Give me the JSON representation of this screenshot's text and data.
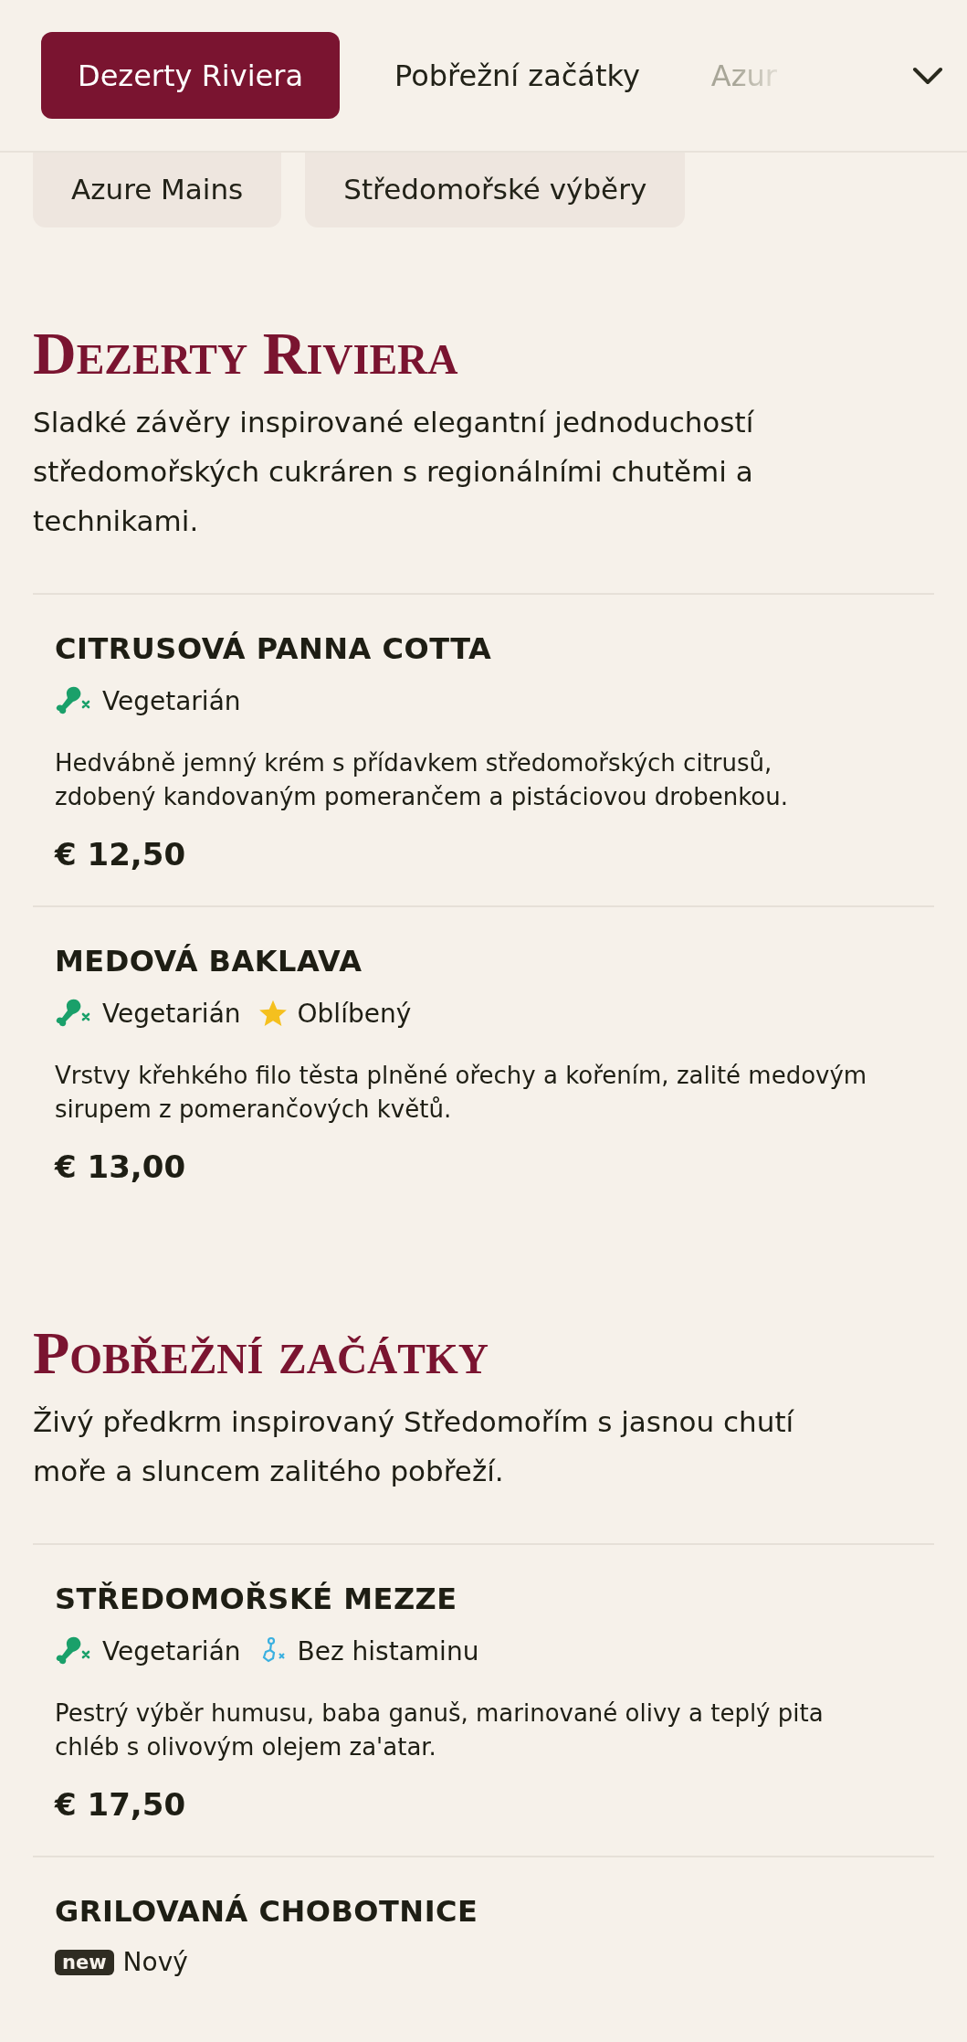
{
  "tabs": [
    {
      "label": "Dezerty Riviera",
      "selected": true
    },
    {
      "label": "Pobřežní začátky",
      "selected": false
    },
    {
      "label": "Azur",
      "selected": false
    }
  ],
  "more_tabs": [
    {
      "label": "Azure Mains",
      "selected": false
    },
    {
      "label": "Středomořské výběry",
      "selected": false
    }
  ],
  "sections": [
    {
      "title": "Dezerty Riviera",
      "description": "Sladké závěry inspirované elegantní jednoduchostí středomořských cukráren s regionálními chutěmi a technikami.",
      "items": [
        {
          "name": "CITRUSOVÁ PANNA COTTA",
          "tags": [
            {
              "kind": "vegetarian",
              "label": "Vegetarián"
            }
          ],
          "description": "Hedvábně jemný krém s přídavkem středomořských citrusů, zdobený kandovaným pomerančem a pistáciovou drobenkou.",
          "price": "€ 12,50"
        },
        {
          "name": "MEDOVÁ BAKLAVA",
          "tags": [
            {
              "kind": "vegetarian",
              "label": "Vegetarián"
            },
            {
              "kind": "popular",
              "label": "Oblíbený"
            }
          ],
          "description": "Vrstvy křehkého filo těsta plněné ořechy a kořením, zalité medovým sirupem z pomerančových květů.",
          "price": "€ 13,00"
        }
      ]
    },
    {
      "title": "Pobřežní začátky",
      "description": "Živý předkrm inspirovaný Středomořím s jasnou chutí moře a sluncem zalitého pobřeží.",
      "items": [
        {
          "name": "STŘEDOMOŘSKÉ MEZZE",
          "tags": [
            {
              "kind": "vegetarian",
              "label": "Vegetarián"
            },
            {
              "kind": "histamine-free",
              "label": "Bez histaminu"
            }
          ],
          "description": "Pestrý výběr humusu, baba ganuš, marinované olivy a teplý pita chléb s olivovým olejem za'atar.",
          "price": "€ 17,50"
        },
        {
          "name": "GRILOVANÁ CHOBOTNICE",
          "tags": [
            {
              "kind": "new",
              "badge": "new",
              "label": "Nový"
            }
          ]
        }
      ]
    }
  ]
}
